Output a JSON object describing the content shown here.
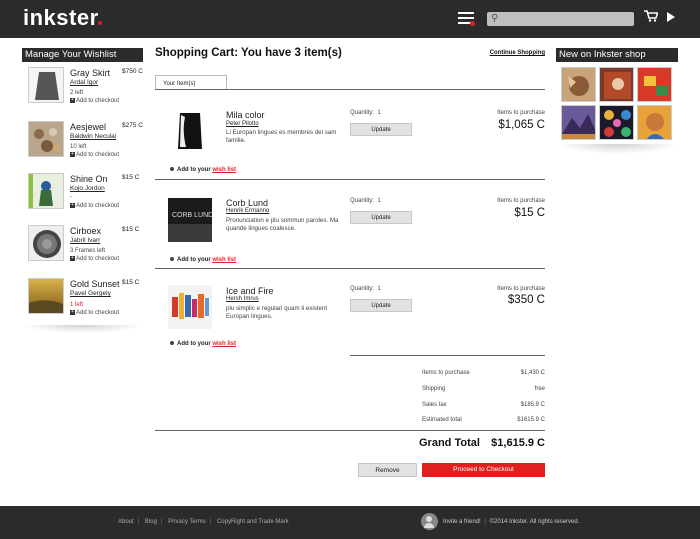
{
  "header": {
    "logo": "inkster",
    "menu_icon": "hamburger-menu-icon",
    "search_placeholder": "",
    "cart_icon": "shopping-cart-icon",
    "play_icon": "play-icon",
    "accent_color": "#e0201f"
  },
  "wishlist": {
    "title": "Manage Your Wishlist",
    "items": [
      {
        "name": "Gray Skirt",
        "author": "Ardal Igor",
        "price": "$750 C",
        "stock": "2 left",
        "stock_alert": false,
        "add_label": "Add to checkout"
      },
      {
        "name": "Aesjewel",
        "author": "Baldwin Neculai",
        "price": "$275 C",
        "stock": "10 left",
        "stock_alert": false,
        "add_label": "Add to checkout"
      },
      {
        "name": "Shine On",
        "author": "Kojo Jordon",
        "price": "$15 C",
        "stock": "-",
        "stock_alert": false,
        "add_label": "Add to checkout"
      },
      {
        "name": "Cirboex",
        "author": "Jabril Ivarr",
        "price": "$15 C",
        "stock": "3 Frames left",
        "stock_alert": false,
        "add_label": "Add to checkout"
      },
      {
        "name": "Gold Sunset",
        "author": "Pavel Gergely",
        "price": "$15 C",
        "stock": "1 left",
        "stock_alert": true,
        "add_label": "Add to checkout"
      }
    ]
  },
  "cart": {
    "title": "Shopping Cart: You have 3 item(s)",
    "continue_label": "Continue Shopping",
    "tab_label": "Your Item(s)",
    "qty_label": "Quantity:",
    "update_label": "Update",
    "items_to_purchase_label": "Items to purchase",
    "add_wishlist_prefix": "Add to your",
    "add_wishlist_link": "wish list",
    "items": [
      {
        "name": "Mila color",
        "author": "Peter Pilotto",
        "desc": "Li Europan lingues es membres del sam familie.",
        "qty": "1",
        "price": "$1,065 C"
      },
      {
        "name": "Corb Lund",
        "author": "Henrik Ermanno",
        "desc": "Pronunciation e plu sommun paroles. Ma quande lingues coalesce.",
        "qty": "1",
        "price": "$15 C"
      },
      {
        "name": "Ice and Fire",
        "author": "Hersh Imrus",
        "desc": "plu simplic e regulari quam li existent Europan lingues.",
        "qty": "1",
        "price": "$350 C"
      }
    ],
    "summary": [
      {
        "label": "Items to purchase",
        "value": "$1,430 C"
      },
      {
        "label": "Shipping",
        "value": "free"
      },
      {
        "label": "Sales tax",
        "value": "$185.9 C"
      },
      {
        "label": "Estimated total",
        "value": "$1615.9 C"
      }
    ],
    "grand_total_label": "Grand Total",
    "grand_total_value": "$1,615.9 C",
    "remove_label": "Remove",
    "checkout_label": "Proceed to Checkout"
  },
  "new_on": {
    "title": "New on Inkster shop"
  },
  "footer": {
    "links": [
      "About",
      "Blog",
      "Privacy Terms",
      "CopyRight and Trade Mark"
    ],
    "invite": "Invite a friend!",
    "copyright": "©2014 Inkster. All rights reserved."
  }
}
